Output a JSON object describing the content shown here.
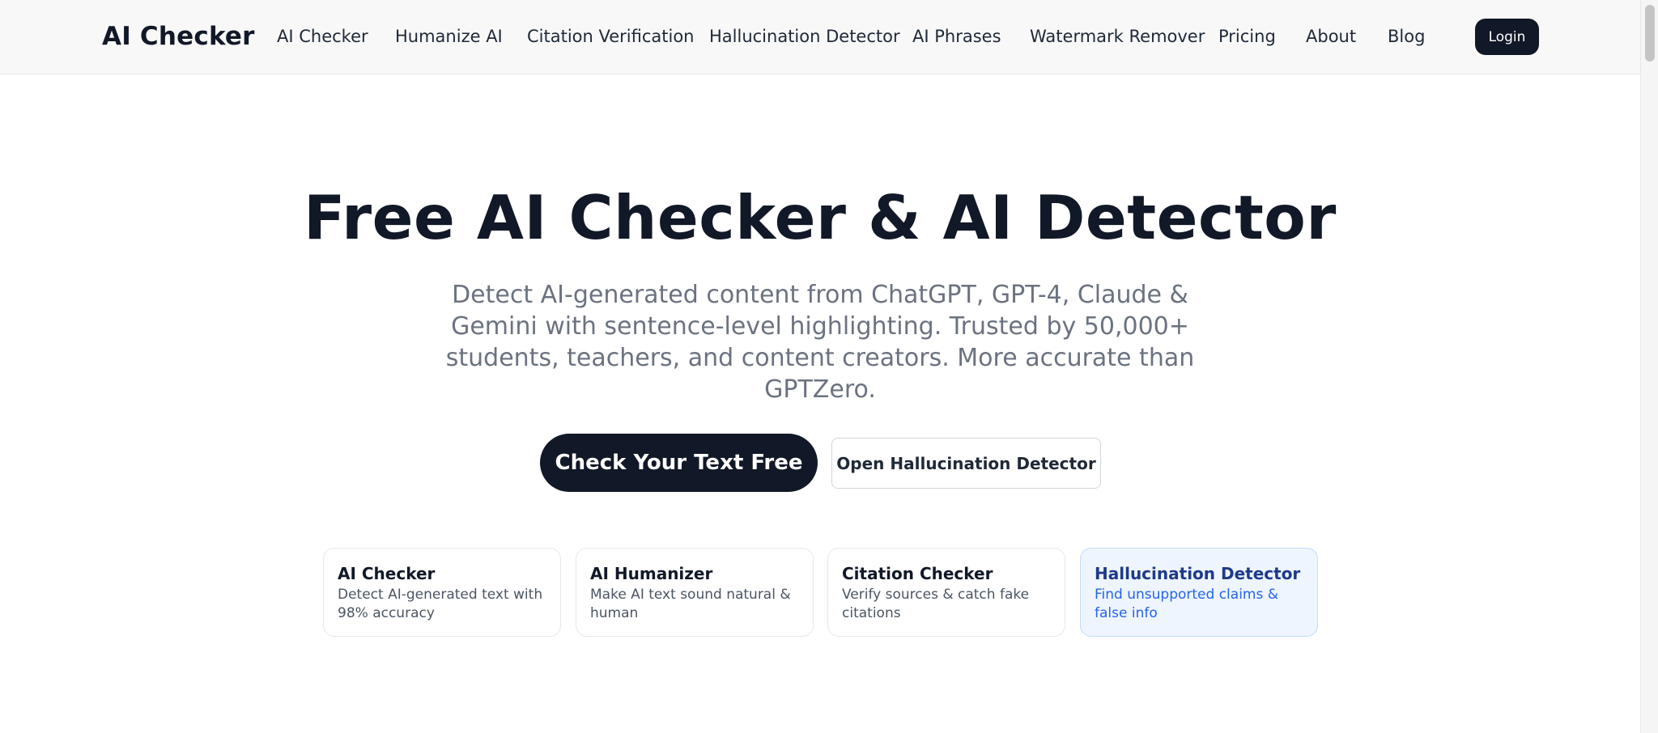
{
  "header": {
    "logo": "AI Checker",
    "nav": [
      {
        "label": "AI Checker"
      },
      {
        "label": "Humanize AI"
      },
      {
        "label": "Citation Verification"
      },
      {
        "label": "Hallucination Detector"
      },
      {
        "label": "AI Phrases"
      },
      {
        "label": "Watermark Remover"
      },
      {
        "label": "Pricing"
      },
      {
        "label": "About"
      },
      {
        "label": "Blog"
      }
    ],
    "login_label": "Login"
  },
  "hero": {
    "title": "Free AI Checker & AI Detector",
    "subtitle": "Detect AI-generated content from ChatGPT, GPT-4, Claude & Gemini with sentence-level highlighting. Trusted by 50,000+ students, teachers, and content creators. More accurate than GPTZero.",
    "primary_cta": "Check Your Text Free",
    "secondary_cta": "Open Hallucination Detector"
  },
  "cards": [
    {
      "title": "AI Checker",
      "desc": "Detect AI-generated text with 98% accuracy"
    },
    {
      "title": "AI Humanizer",
      "desc": "Make AI text sound natural & human"
    },
    {
      "title": "Citation Checker",
      "desc": "Verify sources & catch fake citations"
    },
    {
      "title": "Hallucination Detector",
      "desc": "Find unsupported claims & false info"
    }
  ],
  "colors": {
    "primary_dark": "#111827",
    "highlight_card_bg": "#eef5ff",
    "highlight_card_text": "#2563eb"
  }
}
